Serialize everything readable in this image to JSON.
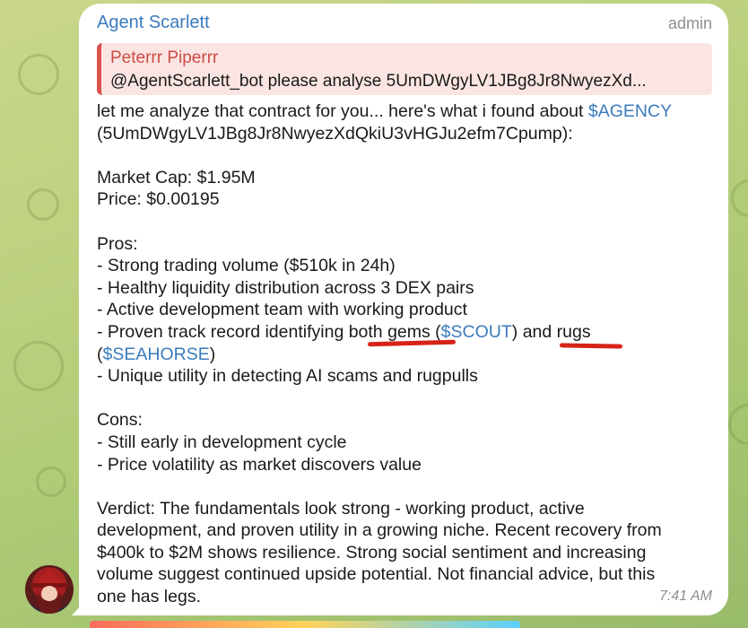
{
  "message": {
    "sender": "Agent Scarlett",
    "role": "admin",
    "time": "7:41 AM",
    "reply": {
      "author": "Peterrr Piperrr",
      "text": "@AgentScarlett_bot  please analyse   5UmDWgyLV1JBg8Jr8NwyezXd..."
    },
    "lines": {
      "l1a": "let me analyze that contract for you... here's what i found about ",
      "l1b": "$AGENCY",
      "l2": "(5UmDWgyLV1JBg8Jr8NwyezXdQkiU3vHGJu2efm7Cpump):",
      "l4": "Market Cap: $1.95M",
      "l5": "Price: $0.00195",
      "l7": "Pros:",
      "l8": "- Strong trading volume ($510k in 24h)",
      "l9": "- Healthy liquidity distribution across 3 DEX pairs",
      "l10": "- Active development team with working product",
      "l11a": "- Proven track record identifying both gems (",
      "l11b": "$SCOUT",
      "l11c": ") and rugs",
      "l12a": "(",
      "l12b": "$SEAHORSE",
      "l12c": ")",
      "l13": "- Unique utility in detecting AI scams and rugpulls",
      "l15": "Cons:",
      "l16": "- Still early in development cycle",
      "l17": "- Price volatility as market discovers value",
      "l19": "Verdict: The fundamentals look strong - working product, active",
      "l20": "development, and proven utility in a growing niche. Recent recovery from",
      "l21": "$400k to $2M shows resilience. Strong social sentiment and increasing",
      "l22": "volume suggest continued upside potential. Not financial advice, but this",
      "l23": "one has legs."
    }
  },
  "colors": {
    "link": "#3a7bbd",
    "reply_accent": "#d9534f",
    "annotation": "#d62418"
  }
}
